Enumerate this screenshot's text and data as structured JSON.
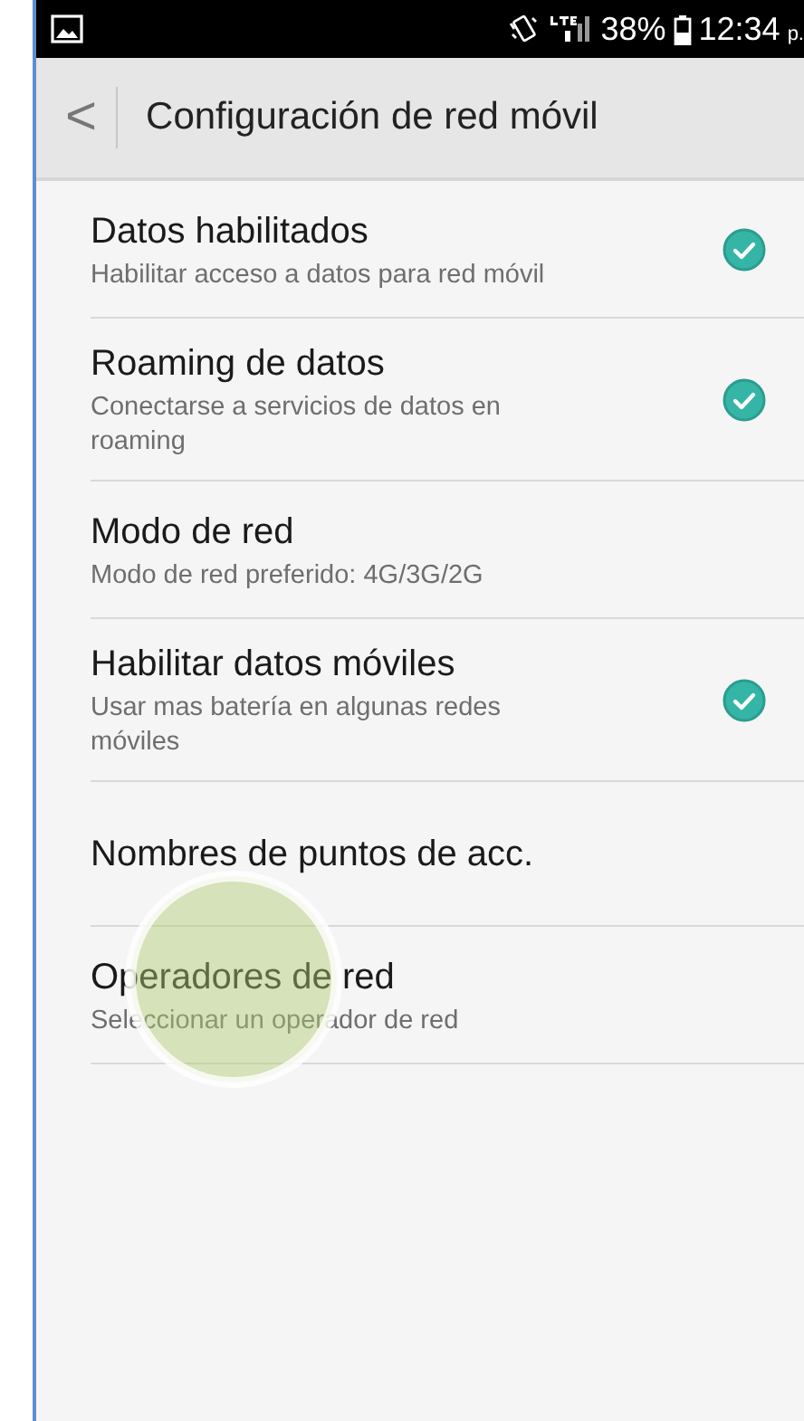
{
  "status_bar": {
    "battery": "38%",
    "time": "12:34",
    "time_suffix": "p."
  },
  "header": {
    "back": "<",
    "title": "Configuración de red móvil"
  },
  "settings": [
    {
      "kind": "check",
      "title": "Datos habilitados",
      "subtitle": "Habilitar acceso a datos para red móvil",
      "checked": true
    },
    {
      "kind": "check",
      "title": "Roaming de datos",
      "subtitle": "Conectarse a servicios de datos en roaming",
      "checked": true
    },
    {
      "kind": "plain",
      "title": "Modo de red",
      "subtitle": "Modo de red preferido: 4G/3G/2G"
    },
    {
      "kind": "check",
      "title": "Habilitar datos móviles",
      "subtitle": "Usar mas batería en algunas redes móviles",
      "checked": true
    },
    {
      "kind": "plain",
      "title": "Nombres de puntos de acc."
    },
    {
      "kind": "plain",
      "title": "Operadores de red",
      "subtitle": "Seleccionar un operador de red",
      "touched": true
    }
  ]
}
